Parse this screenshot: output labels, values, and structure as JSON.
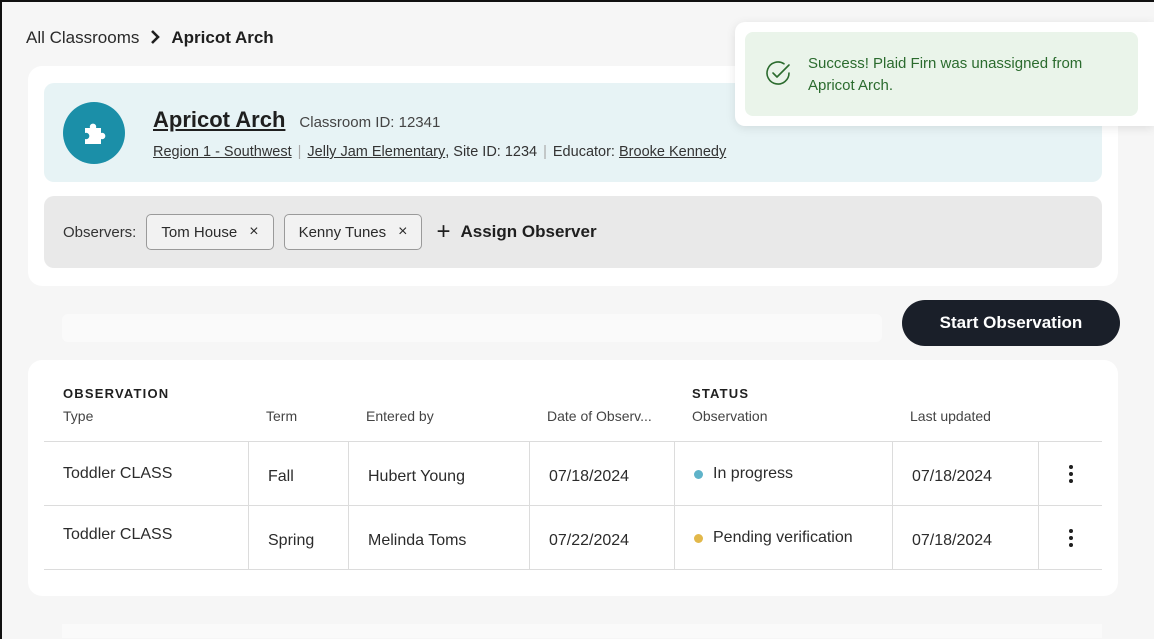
{
  "breadcrumb": {
    "parent": "All Classrooms",
    "separator": "›",
    "current": "Apricot Arch"
  },
  "classroom": {
    "name": "Apricot Arch",
    "id_label": "Classroom ID: 12341",
    "region": "Region 1 - Southwest",
    "school": "Jelly Jam Elementary",
    "site_id": "Site ID: 1234",
    "educator_label": "Educator:",
    "educator": "Brooke Kennedy",
    "icon": "puzzle-icon",
    "icon_color": "#1b8fa8"
  },
  "observers": {
    "label": "Observers:",
    "chips": [
      {
        "name": "Tom House",
        "remove": "×"
      },
      {
        "name": "Kenny Tunes",
        "remove": "×"
      }
    ],
    "assign_plus": "+",
    "assign_label": "Assign Observer"
  },
  "actions": {
    "start_observation": "Start Observation"
  },
  "table": {
    "groups": {
      "observation": "OBSERVATION",
      "status": "STATUS"
    },
    "columns": [
      "Type",
      "Term",
      "Entered by",
      "Date of Observ...",
      "Observation",
      "Last updated"
    ],
    "rows": [
      {
        "type": "Toddler CLASS",
        "term": "Fall",
        "entered_by": "Hubert Young",
        "date": "07/18/2024",
        "status": "In progress",
        "status_color": "#5fb3c9",
        "last_updated": "07/18/2024"
      },
      {
        "type": "Toddler CLASS",
        "term": "Spring",
        "entered_by": "Melinda Toms",
        "date": "07/22/2024",
        "status": "Pending verification",
        "status_color": "#e2b84a",
        "last_updated": "07/18/2024"
      }
    ]
  },
  "toast": {
    "message": "Success! Plaid Firn was unassigned from Apricot Arch.",
    "icon": "check-circle-icon",
    "color": "#2b6b2e"
  }
}
